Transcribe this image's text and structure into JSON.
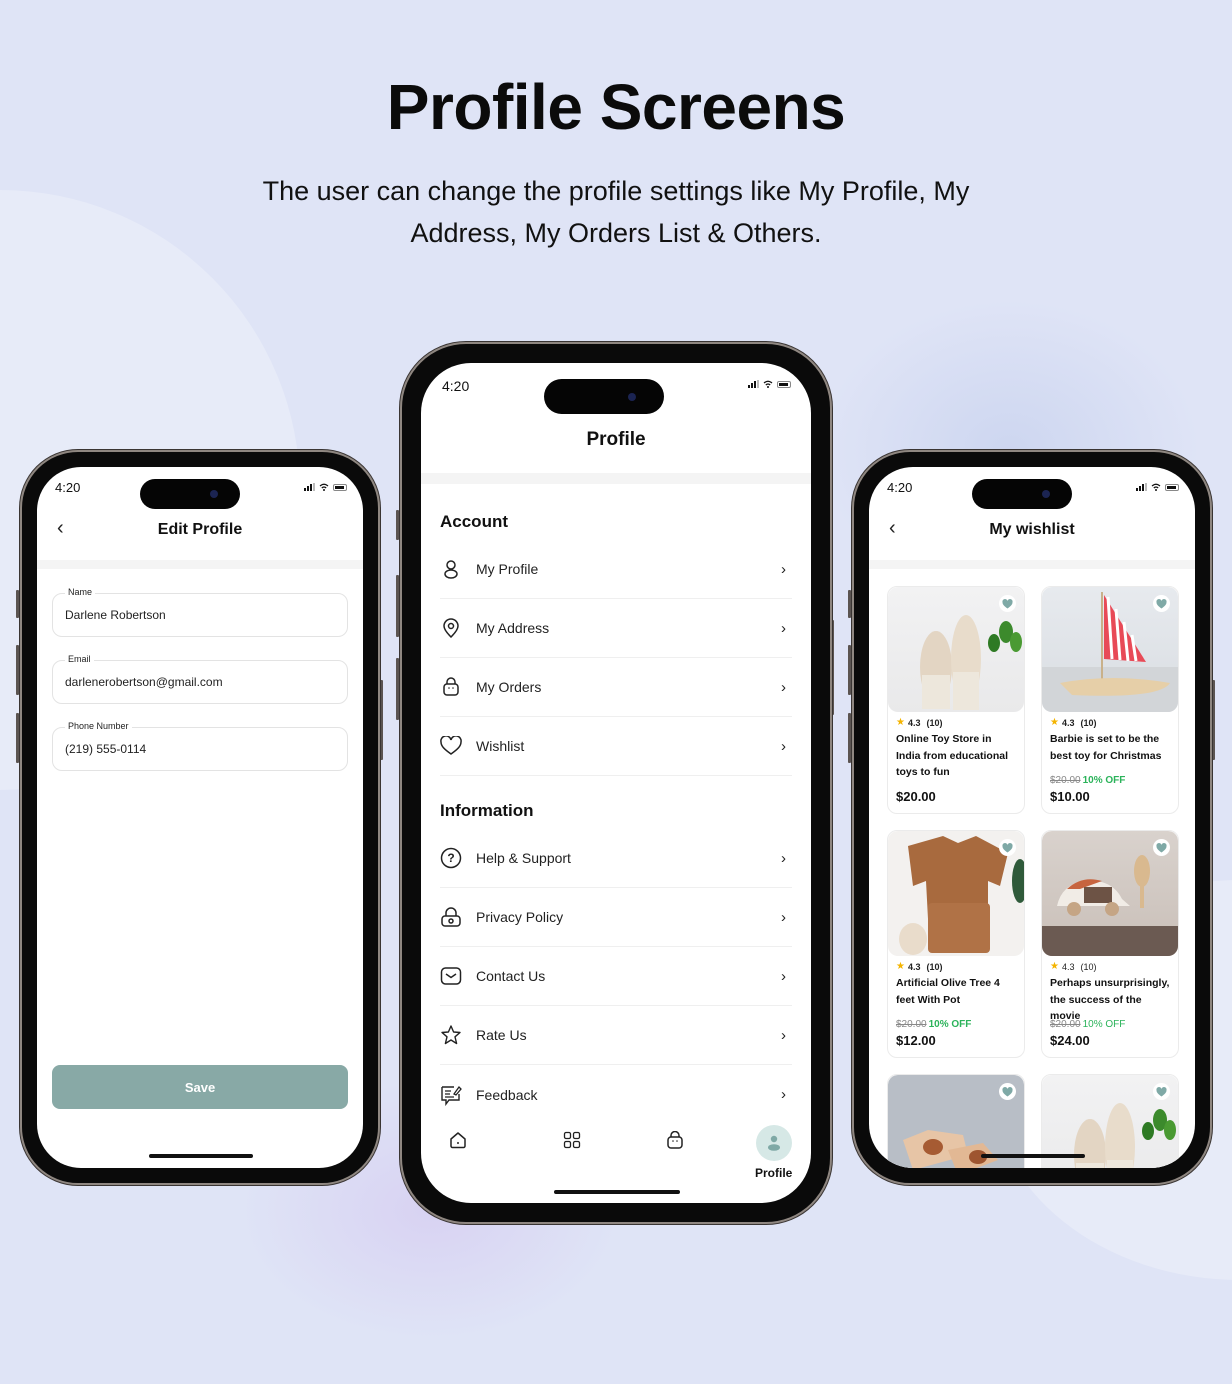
{
  "header": {
    "title": "Profile Screens",
    "subtitle": "The user can change the profile settings like My Profile, My Address, My Orders List & Others."
  },
  "status_bar": {
    "time": "4:20"
  },
  "edit_profile": {
    "title": "Edit Profile",
    "fields": [
      {
        "label": "Name",
        "value": "Darlene Robertson"
      },
      {
        "label": "Email",
        "value": "darlenerobertson@gmail.com"
      },
      {
        "label": "Phone Number",
        "value": "(219) 555-0114"
      }
    ],
    "save_label": "Save",
    "accent_color": "#88a9a6"
  },
  "profile": {
    "title": "Profile",
    "sections": [
      {
        "title": "Account",
        "items": [
          {
            "label": "My Profile",
            "icon": "user-icon"
          },
          {
            "label": "My Address",
            "icon": "location-pin-icon"
          },
          {
            "label": "My Orders",
            "icon": "shopping-bag-icon"
          },
          {
            "label": "Wishlist",
            "icon": "heart-icon"
          }
        ]
      },
      {
        "title": "Information",
        "items": [
          {
            "label": "Help & Support",
            "icon": "help-circle-icon"
          },
          {
            "label": "Privacy Policy",
            "icon": "lock-icon"
          },
          {
            "label": "Contact Us",
            "icon": "mail-icon"
          },
          {
            "label": "Rate Us",
            "icon": "star-icon"
          },
          {
            "label": "Feedback",
            "icon": "feedback-icon"
          }
        ]
      }
    ],
    "tabbar": {
      "items": [
        {
          "name": "home",
          "icon": "home-icon",
          "label": ""
        },
        {
          "name": "categories",
          "icon": "grid-icon",
          "label": ""
        },
        {
          "name": "orders",
          "icon": "bag-icon",
          "label": ""
        },
        {
          "name": "profile",
          "icon": "profile-icon",
          "label": "Profile",
          "active": true
        }
      ]
    }
  },
  "wishlist": {
    "title": "My wishlist",
    "products": [
      {
        "rating": "4.3",
        "reviews": "(10)",
        "title": "Online Toy Store in India from educational toys to fun",
        "old_price": "",
        "discount": "",
        "price": "$20.00",
        "image": "plush-bunnies"
      },
      {
        "rating": "4.3",
        "reviews": "(10)",
        "title": "Barbie is set to be the best toy for Christmas",
        "old_price": "$20.00",
        "discount": "10% OFF",
        "price": "$10.00",
        "image": "wooden-sailboat"
      },
      {
        "rating": "4.3",
        "reviews": "(10)",
        "title": "Artificial Olive Tree 4 feet With Pot",
        "old_price": "$20.00",
        "discount": "10% OFF",
        "price": "$12.00",
        "image": "brown-outfit"
      },
      {
        "rating": "4.3",
        "reviews": "(10)",
        "title": "Perhaps unsurprisingly, the success of the movie",
        "old_price": "$20.00",
        "discount": "10% OFF",
        "price": "$24.00",
        "image": "wooden-car"
      },
      {
        "image": "wooden-animals"
      },
      {
        "image": "plush-bunnies"
      }
    ],
    "heart_color": "#7fa9a6",
    "discount_color": "#2bb35a"
  }
}
